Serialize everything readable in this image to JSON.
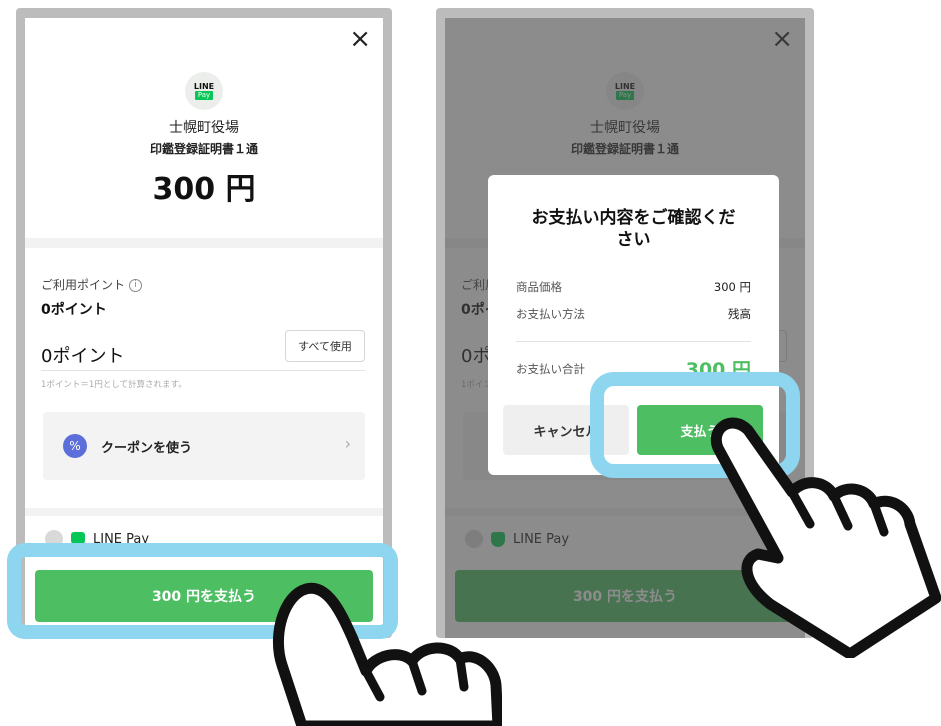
{
  "close_symbol": "×",
  "logo": {
    "line": "LINE",
    "pay": "Pay"
  },
  "merchant": "士幌町役場",
  "item": "印鑑登録証明書１通",
  "amount": "300 円",
  "points": {
    "label": "ご利用ポイント",
    "info_symbol": "i",
    "available": "0ポイント",
    "input_value": "0ポイント",
    "use_all_label": "すべて使用",
    "note": "1ポイント＝1円として計算されます。"
  },
  "coupon": {
    "icon_symbol": "%",
    "label": "クーポンを使う",
    "chevron": "›"
  },
  "payment_method": "LINE Pay",
  "pay_button": "300 円を支払う",
  "dialog": {
    "title": "お支払い内容をご確認ください",
    "rows": [
      {
        "label": "商品価格",
        "value": "300 円"
      },
      {
        "label": "お支払い方法",
        "value": "残高"
      }
    ],
    "total_label": "お支払い合計",
    "total_value": "300 円",
    "cancel_label": "キャンセル",
    "confirm_label": "支払う"
  },
  "colors": {
    "accent_green": "#4dbe62",
    "line_green": "#06c755",
    "highlight_blue": "#8ed5ef",
    "coupon_icon": "#5b6ed9"
  },
  "icons": [
    "close-icon",
    "line-pay-logo",
    "info-icon",
    "coupon-icon",
    "chevron-right-icon",
    "radio-icon",
    "line-pay-shield-icon",
    "pointing-hand-icon"
  ]
}
